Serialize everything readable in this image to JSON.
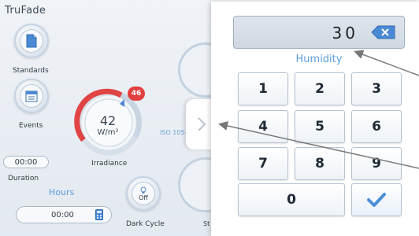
{
  "app": {
    "title": "TruFade"
  },
  "sidebar": {
    "standards_label": "Standards",
    "events_label": "Events",
    "duration_value": "00:00",
    "duration_label": "Duration",
    "hours_label": "Hours",
    "hours_value": "00:00"
  },
  "irradiance": {
    "value": "42",
    "unit": "W/m²",
    "label": "Irradiance",
    "badge": "46",
    "iso_text": "ISO 105-"
  },
  "dark_cycle": {
    "state": "Off",
    "label": "Dark Cycle"
  },
  "partial_label": "St",
  "keypad": {
    "display_value": "30",
    "field_label": "Humidity",
    "keys": [
      "1",
      "2",
      "3",
      "4",
      "5",
      "6",
      "7",
      "8",
      "9",
      "0"
    ],
    "icons": {
      "backspace": "backspace-icon",
      "enter": "checkmark-icon",
      "collapse": "chevron-right-icon"
    }
  },
  "colors": {
    "accent_blue": "#5d9cdc",
    "badge_red": "#e24040",
    "gauge_red": "#e04444",
    "enter_blue": "#4a90d9"
  }
}
